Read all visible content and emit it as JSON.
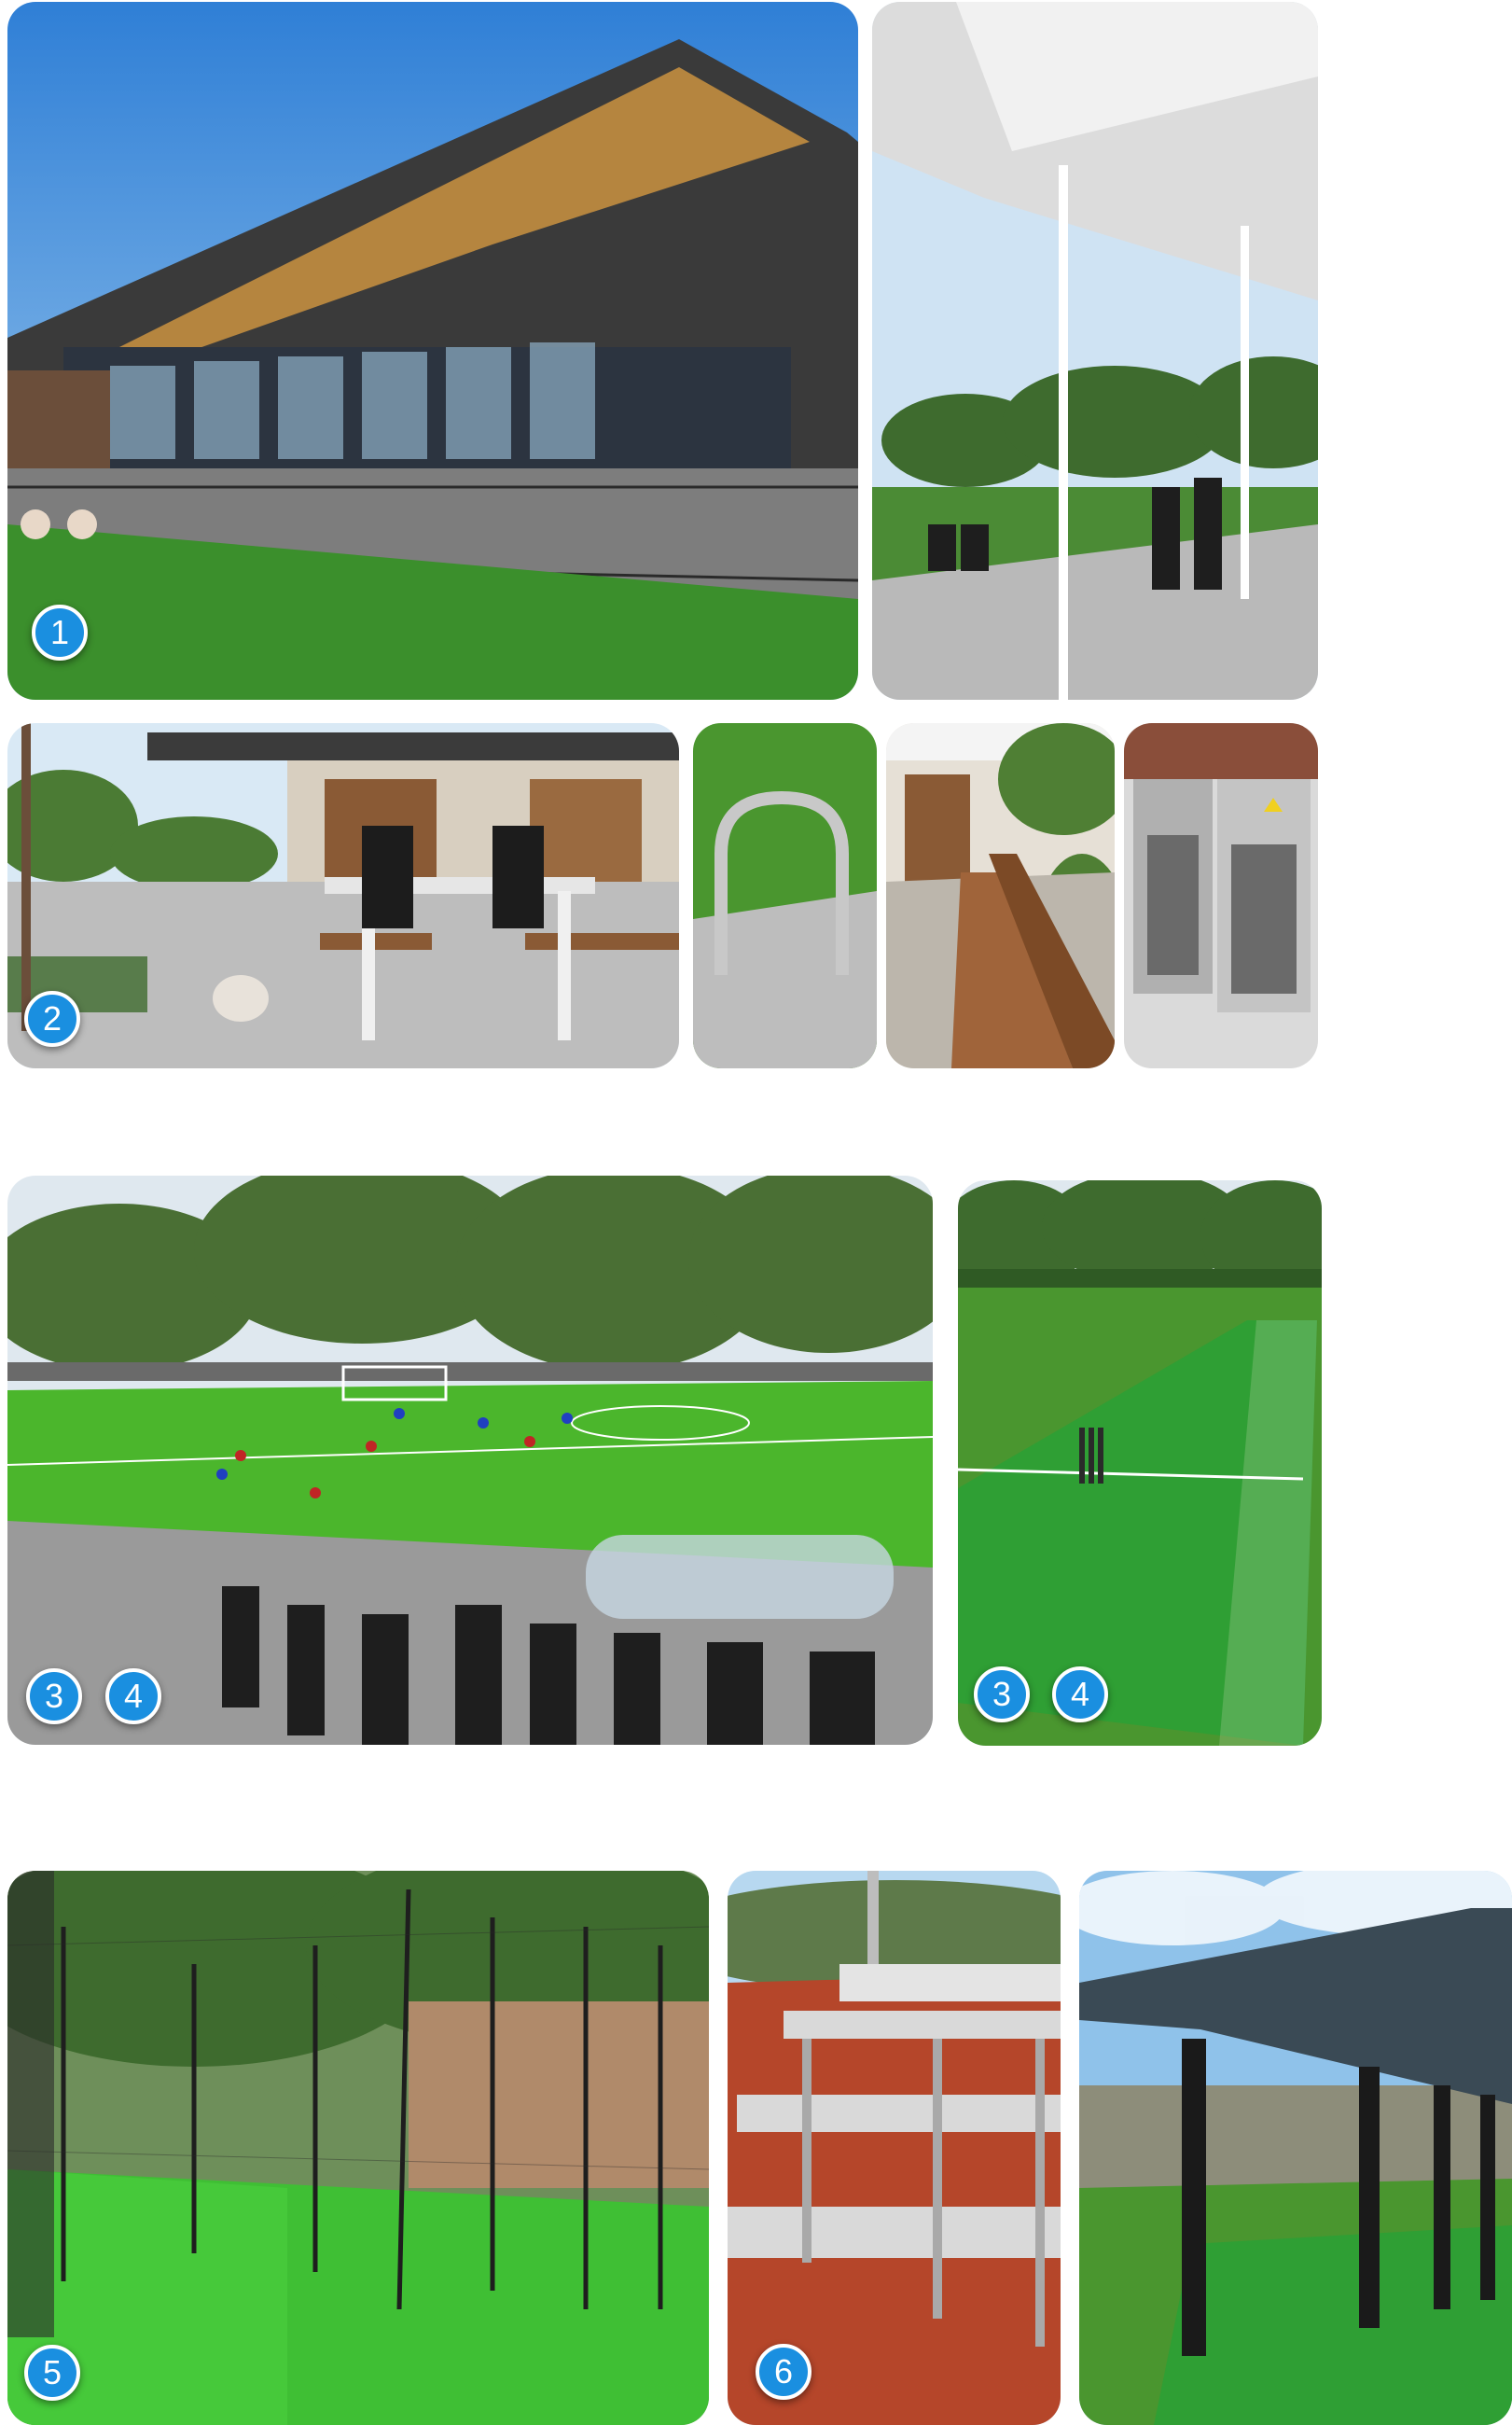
{
  "colors": {
    "badge_fill": "#1a8fe0",
    "badge_border": "#ffffff",
    "turf_green": "#3b8f2c",
    "running_track": "#b5462a"
  },
  "photos": [
    {
      "name": "pavilion-building-photo",
      "badges": [
        "1"
      ]
    },
    {
      "name": "covered-walkway-photo",
      "badges": []
    },
    {
      "name": "picnic-table-photo",
      "badges": [
        "2"
      ]
    },
    {
      "name": "bike-rack-photo",
      "badges": []
    },
    {
      "name": "timber-bench-photo",
      "badges": []
    },
    {
      "name": "waste-bins-photo",
      "badges": []
    },
    {
      "name": "soccer-field-photo",
      "badges": [
        "3",
        "4"
      ]
    },
    {
      "name": "cricket-pitch-photo",
      "badges": [
        "3",
        "4"
      ]
    },
    {
      "name": "cricket-nets-photo",
      "badges": [
        "5"
      ]
    },
    {
      "name": "spectator-seating-photo",
      "badges": [
        "6"
      ]
    },
    {
      "name": "shade-shelter-photo",
      "badges": []
    }
  ]
}
